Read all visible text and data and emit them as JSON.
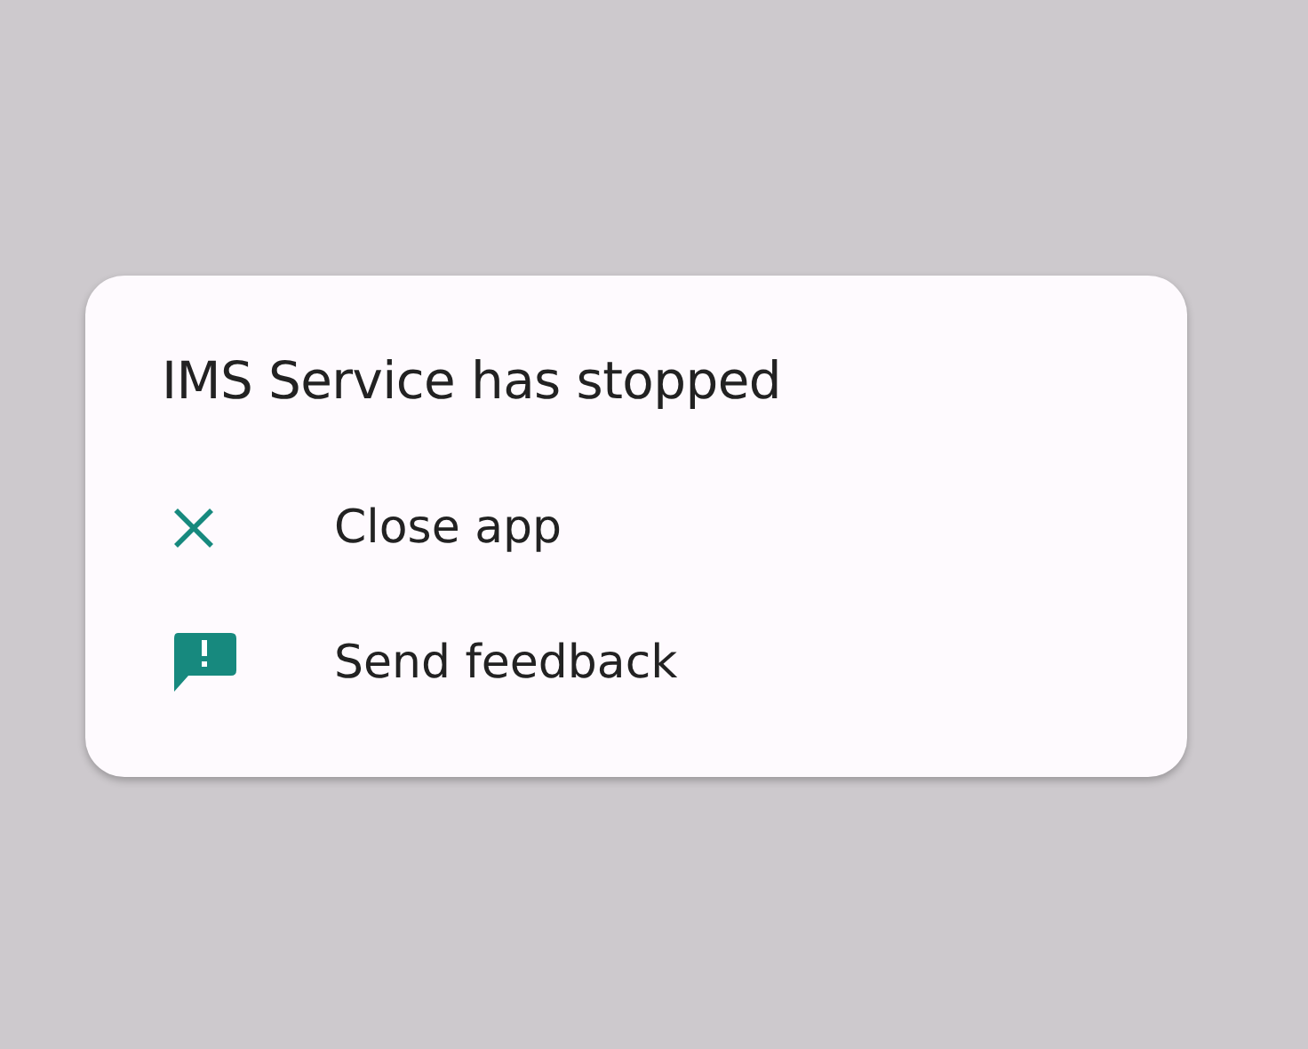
{
  "dialog": {
    "title": "IMS Service has stopped",
    "actions": [
      {
        "kind": "close",
        "label": "Close app"
      },
      {
        "kind": "feedback",
        "label": "Send feedback"
      }
    ]
  }
}
